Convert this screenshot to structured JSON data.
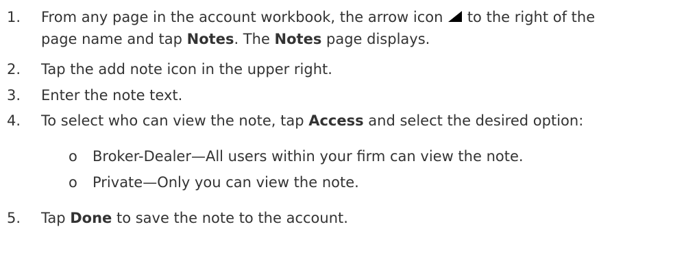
{
  "steps": [
    {
      "number": "1.",
      "line1_pre": "From any page in the account workbook, the arrow icon",
      "line1_post": "to the right of the",
      "line2_pre": "page name and tap ",
      "line2_bold1": "Notes",
      "line2_mid": ". The ",
      "line2_bold2": "Notes",
      "line2_post": " page displays.",
      "icon": "arrow-icon"
    },
    {
      "number": "2.",
      "text": "Tap the add note icon in the upper right."
    },
    {
      "number": "3.",
      "text": "Enter the note text."
    },
    {
      "number": "4.",
      "pre": "To select who can view the note, tap ",
      "bold": "Access",
      "post": " and select the desired option:",
      "options": [
        {
          "bullet": "o",
          "text": "Broker-Dealer—All users within your firm can view the note."
        },
        {
          "bullet": "o",
          "text": "Private—Only you can view the note."
        }
      ]
    },
    {
      "number": "5.",
      "pre": "Tap ",
      "bold": "Done",
      "post": " to save the note to the account."
    }
  ],
  "colors": {
    "text": "#333333",
    "icon": "#000000"
  }
}
